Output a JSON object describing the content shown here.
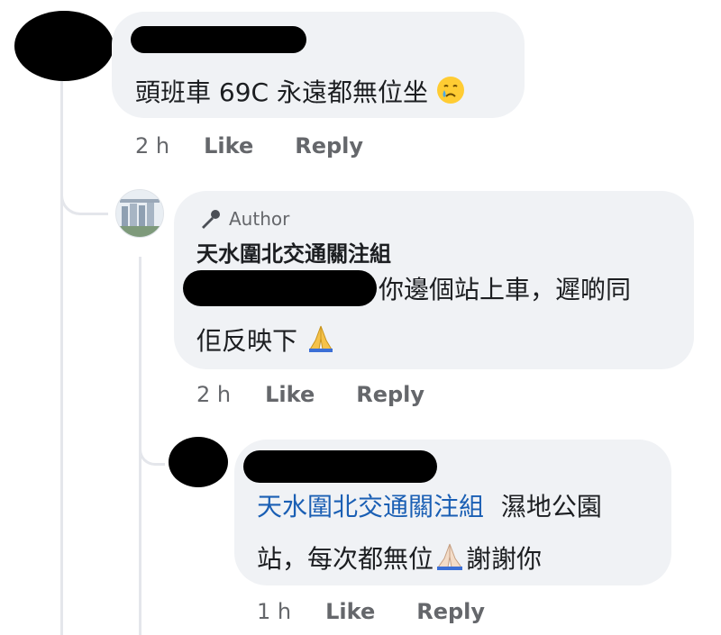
{
  "comment1": {
    "text": "頭班車 69C 永遠都無位坐",
    "emoji": "crying-face",
    "time": "2 h",
    "like": "Like",
    "reply": "Reply"
  },
  "comment2": {
    "badge": "Author",
    "author": "天水圍北交通關注組",
    "line1": "你邊個站上車，遲啲同",
    "line2": "佢反映下",
    "emoji": "folded-hands",
    "time": "2 h",
    "like": "Like",
    "reply": "Reply"
  },
  "comment3": {
    "mention": "天水圍北交通關注組",
    "line1_rest": "濕地公園",
    "line2a": "站，每次都無位",
    "line2b": "謝謝你",
    "emoji": "folded-hands",
    "time": "1 h",
    "like": "Like",
    "reply": "Reply"
  },
  "colors": {
    "bubble": "#f0f2f5",
    "meta": "#65676b",
    "mention": "#1a5fb4"
  }
}
